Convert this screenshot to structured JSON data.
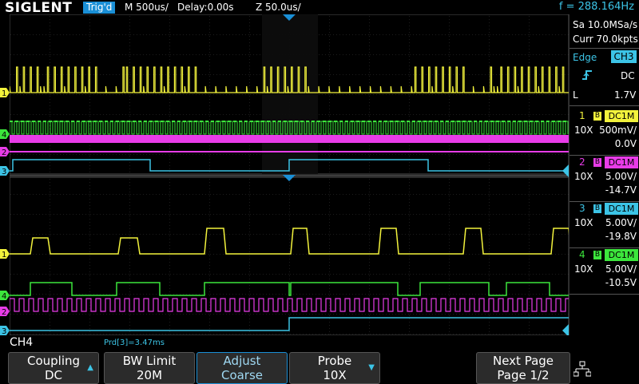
{
  "header": {
    "brand": "SIGLENT",
    "trigger_state": "Trig'd",
    "timebase": "M 500us/",
    "delay": "Delay:0.00s",
    "zoom": "Z 50.0us/",
    "frequency": "f = 288.164Hz"
  },
  "acquisition": {
    "sample_rate": "Sa 10.0MSa/s",
    "curr_points": "Curr 70.0kpts"
  },
  "trigger": {
    "type": "Edge",
    "source": "CH3",
    "coupling": "DC",
    "level_label": "L",
    "level": "1.7V"
  },
  "channels": [
    {
      "num": "1",
      "bw": "B",
      "coupling": "DC1M",
      "probe": "10X",
      "scale": "500mV/",
      "offset": "0.0V",
      "color": "#f2f23c"
    },
    {
      "num": "2",
      "bw": "B",
      "coupling": "DC1M",
      "probe": "10X",
      "scale": "5.00V/",
      "offset": "-14.7V",
      "color": "#e83ce8"
    },
    {
      "num": "3",
      "bw": "B",
      "coupling": "DC1M",
      "probe": "10X",
      "scale": "5.00V/",
      "offset": "-19.8V",
      "color": "#3cc4e6"
    },
    {
      "num": "4",
      "bw": "B",
      "coupling": "DC1M",
      "probe": "10X",
      "scale": "5.00V/",
      "offset": "-10.5V",
      "color": "#3ce63c"
    }
  ],
  "status": {
    "active_channel": "CH4",
    "measurement": "Prd[3]=3.47ms"
  },
  "softkeys": [
    {
      "line1": "Coupling",
      "line2": "DC",
      "arrow": "▲"
    },
    {
      "line1": "BW Limit",
      "line2": "20M",
      "arrow": ""
    },
    {
      "line1": "Adjust",
      "line2": "Coarse",
      "arrow": ""
    },
    {
      "line1": "Probe",
      "line2": "10X",
      "arrow": "▼"
    },
    {
      "line1": "Next Page",
      "line2": "Page 1/2",
      "arrow": ""
    }
  ],
  "colors": {
    "ch1": "#f2f23c",
    "ch2": "#e83ce8",
    "ch3": "#3cc4e6",
    "ch4": "#3ce63c",
    "accent": "#1a8fd6"
  }
}
